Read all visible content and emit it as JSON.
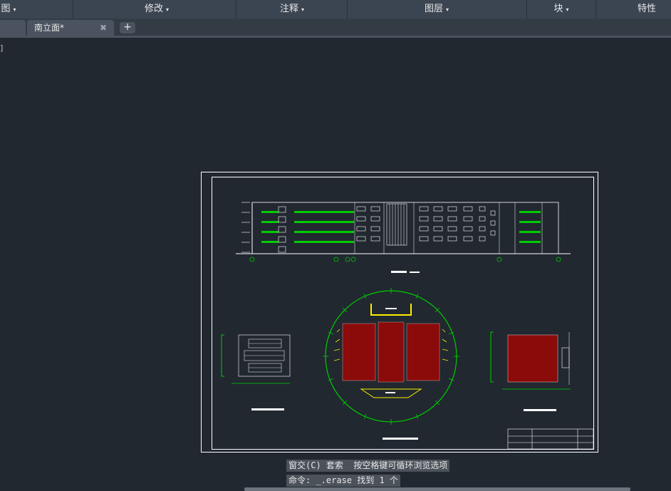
{
  "menubar": {
    "items": [
      {
        "label": "图",
        "arrow": "▾"
      },
      {
        "label": "修改",
        "arrow": "▾"
      },
      {
        "label": "注释",
        "arrow": "▾"
      },
      {
        "label": "图层",
        "arrow": "▾"
      },
      {
        "label": "块",
        "arrow": "▾"
      },
      {
        "label": "特性",
        "arrow": ""
      }
    ]
  },
  "tabs": {
    "active_label": "南立面*",
    "close_glyph": "✖",
    "add_glyph": "+"
  },
  "viewport": {
    "corner_label": "]"
  },
  "command": {
    "line1": "窗交(C) 套索  按空格键可循环浏览选项",
    "line2": "命令: _.erase 找到 1 个"
  },
  "colors": {
    "background": "#212830",
    "menubar": "#3b4451",
    "drawing_white": "#ffffff",
    "drawing_green": "#00cc00",
    "drawing_yellow": "#ffee00",
    "seat_red": "#8b0a0a"
  }
}
